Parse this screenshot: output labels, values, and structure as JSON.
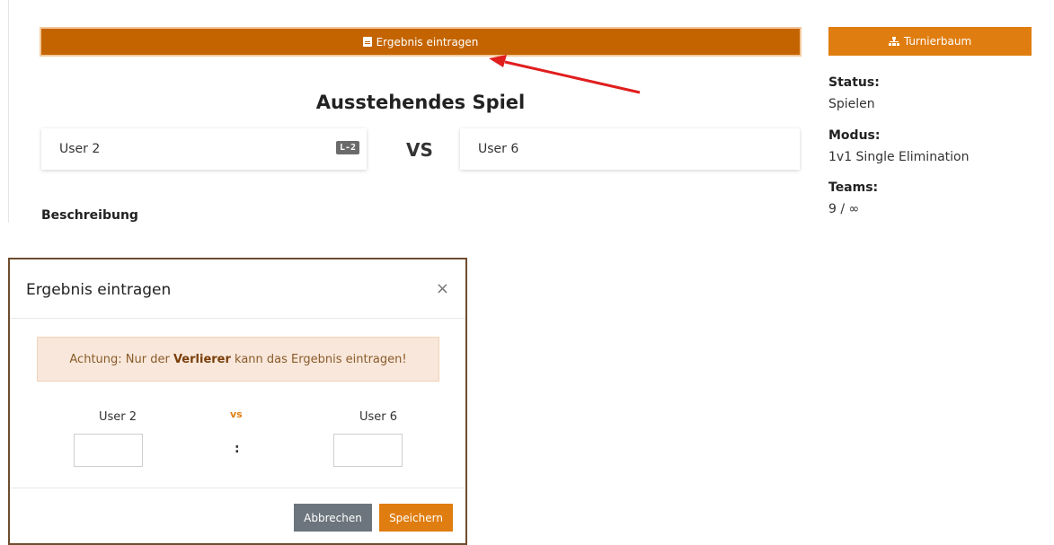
{
  "toolbar": {
    "enter_result_label": "Ergebnis eintragen",
    "tree_label": "Turnierbaum"
  },
  "match": {
    "heading": "Ausstehendes Spiel",
    "player1": "User 2",
    "player1_badge": "L-2",
    "vs": "VS",
    "player2": "User 6",
    "description_label": "Beschreibung"
  },
  "info": {
    "status_label": "Status:",
    "status_value": "Spielen",
    "mode_label": "Modus:",
    "mode_value": "1v1 Single Elimination",
    "teams_label": "Teams:",
    "teams_value": "9 / ∞"
  },
  "modal": {
    "title": "Ergebnis eintragen",
    "close": "×",
    "alert_prefix": "Achtung: Nur der ",
    "alert_bold": "Verlierer",
    "alert_suffix": " kann das Ergebnis eintragen!",
    "team_left": "User 2",
    "vs": "vs",
    "team_right": "User 6",
    "separator": ":",
    "score_left": "",
    "score_right": "",
    "cancel_label": "Abbrechen",
    "save_label": "Speichern"
  },
  "colors": {
    "primary": "#c46400",
    "accent": "#e07d10",
    "alert_bg": "#f8e7da",
    "cancel_bg": "#6c757d",
    "annotation_arrow": "#e01e1e"
  }
}
